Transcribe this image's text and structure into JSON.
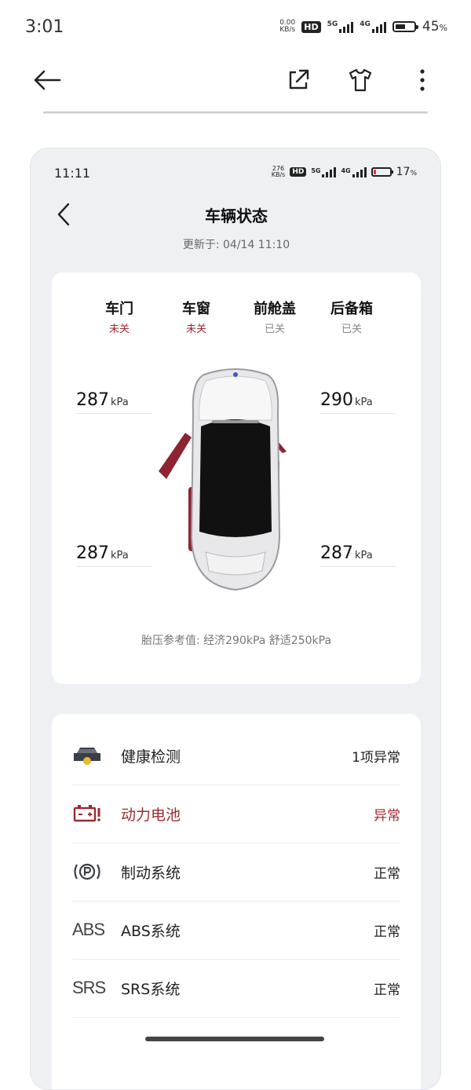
{
  "status_bar": {
    "time": "3:01",
    "net_speed_value": "0.00",
    "net_speed_unit": "KB/s",
    "hd_badge": "HD",
    "sig1_label": "5G",
    "sig2_label": "4G",
    "battery_percent": "45",
    "battery_symbol": "%",
    "battery_level": 0.45
  },
  "toolbar": {
    "back_icon": "arrow-left-icon",
    "share_icon": "share-external-icon",
    "theme_icon": "tshirt-icon",
    "more_icon": "more-vertical-icon"
  },
  "inner_status_bar": {
    "time": "11:11",
    "net_speed_value": "276",
    "net_speed_unit": "KB/s",
    "hd_badge": "HD",
    "sig1_label": "5G",
    "sig2_label": "4G",
    "battery_percent": "17",
    "battery_symbol": "%",
    "battery_level": 0.17,
    "battery_color": "#d9383f"
  },
  "header": {
    "title": "车辆状态",
    "updated": "更新于: 04/14 11:10"
  },
  "closures": [
    {
      "label": "车门",
      "status": "未关",
      "state": "open"
    },
    {
      "label": "车窗",
      "status": "未关",
      "state": "open"
    },
    {
      "label": "前舱盖",
      "status": "已关",
      "state": "closed"
    },
    {
      "label": "后备箱",
      "status": "已关",
      "state": "closed"
    }
  ],
  "tires": {
    "unit": "kPa",
    "front_left": "287",
    "front_right": "290",
    "rear_left": "287",
    "rear_right": "287"
  },
  "tire_reference": "胎压参考值: 经济290kPa  舒适250kPa",
  "health": {
    "rows": [
      {
        "icon": "car-check-icon",
        "label": "健康检测",
        "status": "1项异常",
        "warn": false
      },
      {
        "icon": "battery-warning-icon",
        "label": "动力电池",
        "status": "异常",
        "warn": true
      },
      {
        "icon": "parking-brake-icon",
        "label": "制动系统",
        "status": "正常",
        "warn": false
      },
      {
        "icon_text": "ABS",
        "label": "ABS系统",
        "status": "正常",
        "warn": false
      },
      {
        "icon_text": "SRS",
        "label": "SRS系统",
        "status": "正常",
        "warn": false
      }
    ]
  },
  "colors": {
    "accent_warning": "#9a2b34",
    "door_open": "#8e2333",
    "card_bg": "#ffffff",
    "page_bg": "#eef0f4"
  }
}
